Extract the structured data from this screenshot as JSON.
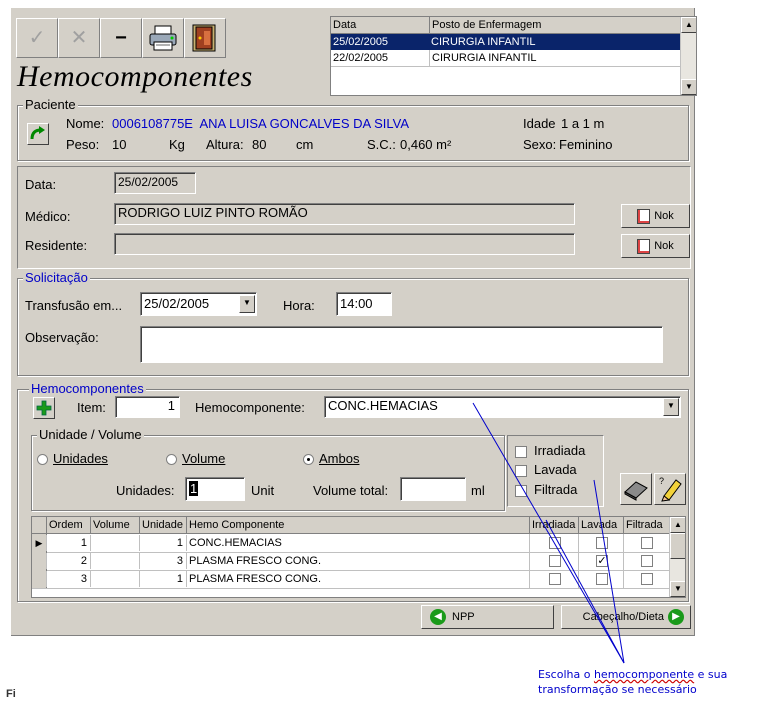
{
  "toolbar": {
    "confirm_icon": "checkmark-icon",
    "cancel_icon": "x-icon",
    "minimize_icon": "minus-icon",
    "printer_icon": "printer-icon",
    "exit_icon": "door-exit-icon"
  },
  "form_title": "Hemocomponentes",
  "history": {
    "columns": [
      "Data",
      "Posto de Enfermagem"
    ],
    "rows": [
      {
        "data": "25/02/2005",
        "posto": "CIRURGIA INFANTIL",
        "selected": true
      },
      {
        "data": "22/02/2005",
        "posto": "CIRURGIA INFANTIL",
        "selected": false
      }
    ]
  },
  "paciente": {
    "legend": "Paciente",
    "nome_label": "Nome:",
    "nome_value": "0006108775E  ANA LUISA GONCALVES DA SILVA",
    "idade_label": "Idade",
    "idade_value": "1 a 1 m",
    "peso_label": "Peso:",
    "peso_value": "10",
    "peso_unit": "Kg",
    "altura_label": "Altura:",
    "altura_value": "80",
    "altura_unit": "cm",
    "sc_label": "S.C.:",
    "sc_value": "0,460 m²",
    "sexo_label": "Sexo:",
    "sexo_value": "Feminino"
  },
  "info": {
    "data_label": "Data:",
    "data_value": "25/02/2005",
    "medico_label": "Médico:",
    "medico_value": "RODRIGO LUIZ PINTO ROMÃO",
    "residente_label": "Residente:",
    "residente_value": "",
    "nok_label": "Nok"
  },
  "solicitacao": {
    "legend": "Solicitação",
    "transfusao_label": "Transfusão em...",
    "transfusao_value": "25/02/2005",
    "hora_label": "Hora:",
    "hora_value": "14:00",
    "observacao_label": "Observação:",
    "observacao_value": ""
  },
  "hemocomponentes": {
    "legend": "Hemocomponentes",
    "item_label": "Item:",
    "item_value": "1",
    "hemo_label": "Hemocomponente:",
    "hemo_value": "CONC.HEMACIAS",
    "unidade_volume_legend": "Unidade / Volume",
    "radio_unidades": "Unidades",
    "radio_volume": "Volume",
    "radio_ambos": "Ambos",
    "unidades_label": "Unidades:",
    "unidades_value": "1",
    "unidades_unit": "Unit",
    "volume_total_label": "Volume total:",
    "volume_total_value": "",
    "volume_unit": "ml",
    "irradiada": "Irradiada",
    "lavada": "Lavada",
    "filtrada": "Filtrada"
  },
  "table": {
    "columns": [
      "Ordem",
      "Volume",
      "Unidade",
      "Hemo Componente",
      "Irradiada",
      "Lavada",
      "Filtrada"
    ],
    "rows": [
      {
        "ordem": "1",
        "volume": "",
        "unidade": "1",
        "hemo": "CONC.HEMACIAS",
        "irradiada": false,
        "lavada": false,
        "filtrada": false
      },
      {
        "ordem": "2",
        "volume": "",
        "unidade": "3",
        "hemo": "PLASMA FRESCO CONG.",
        "irradiada": false,
        "lavada": true,
        "filtrada": false
      },
      {
        "ordem": "3",
        "volume": "",
        "unidade": "1",
        "hemo": "PLASMA FRESCO CONG.",
        "irradiada": false,
        "lavada": false,
        "filtrada": false
      }
    ]
  },
  "footer": {
    "npp_label": "NPP",
    "cabecalho_label": "Cabeçalho/Dieta"
  },
  "annotation": {
    "line1_pre": "Escolha o ",
    "line1_word": "hemocomponente",
    "line1_post": " e sua",
    "line2": "transformação se necessário",
    "color": "#0000cc"
  },
  "page_footer_mark": "Fi"
}
